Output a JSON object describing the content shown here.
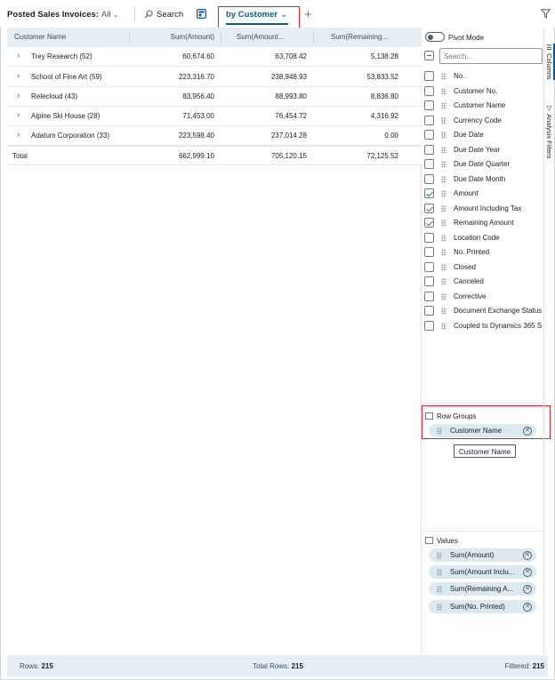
{
  "toolbar": {
    "title": "Posted Sales Invoices:",
    "filter": "All",
    "search_label": "Search",
    "tab_label": "by Customer",
    "add_label": "+"
  },
  "grid": {
    "columns": [
      "Customer Name",
      "Sum(Amount)",
      "Sum(Amount...",
      "Sum(Remaining..."
    ],
    "rows": [
      {
        "name": "Trey Research (52)",
        "amount": "60,674.60",
        "amount_incl": "63,708.42",
        "remaining": "5,138.28"
      },
      {
        "name": "School of Fine Art (59)",
        "amount": "223,316.70",
        "amount_incl": "238,948.93",
        "remaining": "53,833.52"
      },
      {
        "name": "Relecloud (43)",
        "amount": "83,956.40",
        "amount_incl": "88,993.80",
        "remaining": "8,836.80"
      },
      {
        "name": "Alpine Ski House (28)",
        "amount": "71,453.00",
        "amount_incl": "76,454.72",
        "remaining": "4,316.92"
      },
      {
        "name": "Adatum Corporation (33)",
        "amount": "223,598.40",
        "amount_incl": "237,014.28",
        "remaining": "0.00"
      }
    ],
    "total": {
      "name": "Total",
      "amount": "662,999.10",
      "amount_incl": "705,120.15",
      "remaining": "72,125.52"
    }
  },
  "panel": {
    "pivot_label": "Pivot Mode",
    "search_placeholder": "Search...",
    "fields": [
      {
        "label": "No.",
        "checked": false
      },
      {
        "label": "Customer No.",
        "checked": false
      },
      {
        "label": "Customer Name",
        "checked": false
      },
      {
        "label": "Currency Code",
        "checked": false
      },
      {
        "label": "Due Date",
        "checked": false
      },
      {
        "label": "Due Date Year",
        "checked": false
      },
      {
        "label": "Due Date Quarter",
        "checked": false
      },
      {
        "label": "Due Date Month",
        "checked": false
      },
      {
        "label": "Amount",
        "checked": true
      },
      {
        "label": "Amount Including Tax",
        "checked": true
      },
      {
        "label": "Remaining Amount",
        "checked": true
      },
      {
        "label": "Location Code",
        "checked": false
      },
      {
        "label": "No. Printed",
        "checked": false
      },
      {
        "label": "Closed",
        "checked": false
      },
      {
        "label": "Canceled",
        "checked": false
      },
      {
        "label": "Corrective",
        "checked": false
      },
      {
        "label": "Document Exchange Status",
        "checked": false
      },
      {
        "label": "Coupled to Dynamics 365 S",
        "checked": false
      }
    ],
    "row_groups_title": "Row Groups",
    "row_groups": [
      "Customer Name"
    ],
    "tooltip": "Customer Name",
    "values_title": "Values",
    "values": [
      "Sum(Amount)",
      "Sum(Amount Inclu...",
      "Sum(Remaining A...",
      "Sum(No. Printed)"
    ]
  },
  "side_tabs": [
    "Columns",
    "Analysis Filters"
  ],
  "status": {
    "rows_label": "Rows:",
    "rows": "215",
    "total_label": "Total Rows:",
    "total": "215",
    "filtered_label": "Filtered:",
    "filtered": "215"
  }
}
